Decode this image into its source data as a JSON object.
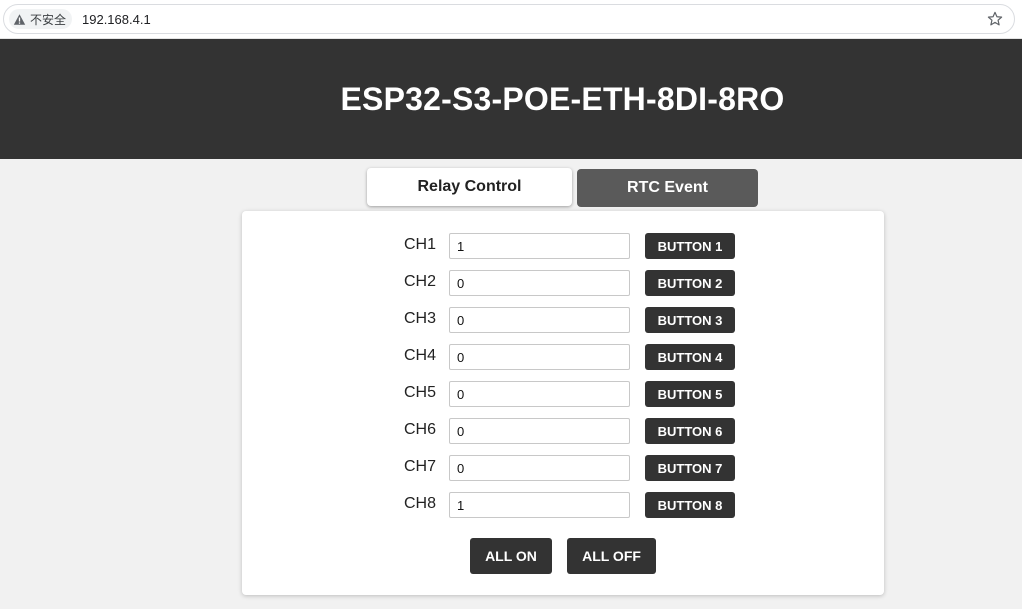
{
  "browser": {
    "security_label": "不安全",
    "url": "192.168.4.1"
  },
  "header": {
    "title": "ESP32-S3-POE-ETH-8DI-8RO"
  },
  "tabs": [
    {
      "label": "Relay Control",
      "active": true
    },
    {
      "label": "RTC Event",
      "active": false
    }
  ],
  "channels": [
    {
      "label": "CH1",
      "value": "1",
      "button": "BUTTON 1"
    },
    {
      "label": "CH2",
      "value": "0",
      "button": "BUTTON 2"
    },
    {
      "label": "CH3",
      "value": "0",
      "button": "BUTTON 3"
    },
    {
      "label": "CH4",
      "value": "0",
      "button": "BUTTON 4"
    },
    {
      "label": "CH5",
      "value": "0",
      "button": "BUTTON 5"
    },
    {
      "label": "CH6",
      "value": "0",
      "button": "BUTTON 6"
    },
    {
      "label": "CH7",
      "value": "0",
      "button": "BUTTON 7"
    },
    {
      "label": "CH8",
      "value": "1",
      "button": "BUTTON 8"
    }
  ],
  "actions": {
    "all_on": "ALL ON",
    "all_off": "ALL OFF"
  },
  "colors": {
    "header_bg": "#333333",
    "button_bg": "#333333",
    "inactive_tab_bg": "#5a5a5a",
    "page_bg": "#f1f1f1"
  }
}
